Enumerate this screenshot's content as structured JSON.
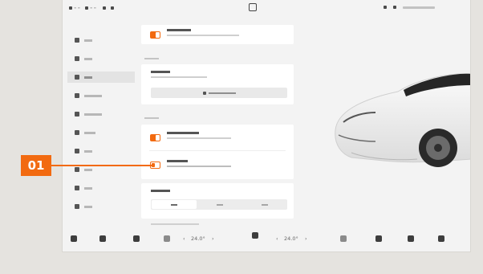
{
  "callout": {
    "label": "01"
  },
  "status_bar": {
    "left_items": [
      "≡ ≡",
      "≡ ≡"
    ],
    "center_icon": "vehicle-status-icon"
  },
  "sidebar": {
    "items": [
      {
        "icon": "car-icon"
      },
      {
        "icon": "bolt-icon"
      },
      {
        "icon": "sliders-icon",
        "active": true
      },
      {
        "icon": "steering-icon"
      },
      {
        "icon": "shield-icon"
      },
      {
        "icon": "lightbulb-icon"
      },
      {
        "icon": "wrench-icon"
      },
      {
        "icon": "sun-icon"
      },
      {
        "icon": "bluetooth-icon"
      },
      {
        "icon": "globe-icon"
      }
    ]
  },
  "settings": {
    "toggles": [
      {
        "state": "on"
      },
      {
        "state": "on"
      },
      {
        "state": "off"
      }
    ],
    "segments": {
      "selected_index": 0,
      "count": 3
    }
  },
  "dock": {
    "temp_left": "24.0°",
    "temp_right": "24.0°",
    "icons": [
      "car-icon",
      "vehicle-icon",
      "seat-icon",
      "fan-icon",
      "defrost-icon",
      "defrost-icon",
      "music-icon",
      "apps-icon",
      "camera-icon"
    ]
  },
  "colors": {
    "accent": "#f26a10",
    "screen_bg": "#f3f3f3",
    "page_bg": "#e5e3df"
  }
}
